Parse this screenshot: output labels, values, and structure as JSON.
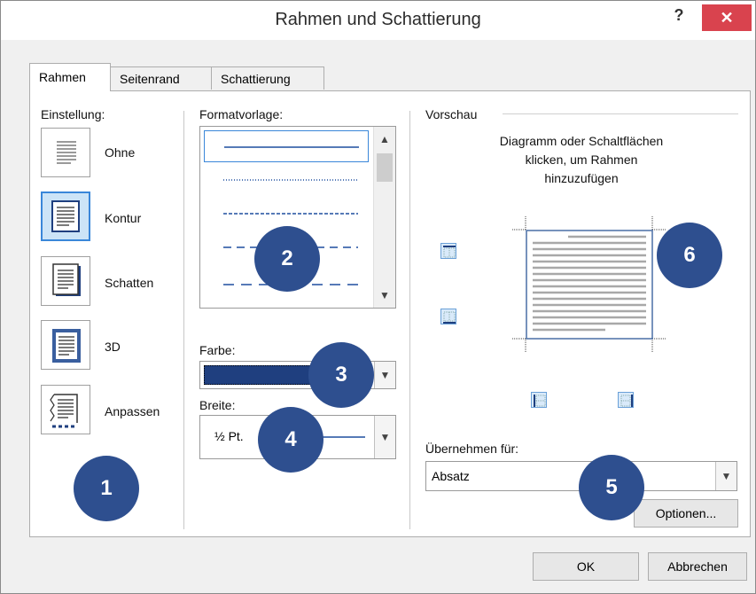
{
  "dialog": {
    "title": "Rahmen und Schattierung",
    "help_label": "?",
    "close_label": "✕"
  },
  "tabs": [
    {
      "label": "Rahmen",
      "active": true
    },
    {
      "label": "Seitenrand",
      "active": false
    },
    {
      "label": "Schattierung",
      "active": false
    }
  ],
  "settings": {
    "header": "Einstellung:",
    "items": [
      {
        "label": "Ohne",
        "icon": "no-border-icon",
        "selected": false
      },
      {
        "label": "Kontur",
        "icon": "box-border-icon",
        "selected": true
      },
      {
        "label": "Schatten",
        "icon": "shadow-border-icon",
        "selected": false
      },
      {
        "label": "3D",
        "icon": "3d-border-icon",
        "selected": false
      },
      {
        "label": "Anpassen",
        "icon": "custom-border-icon",
        "selected": false
      }
    ]
  },
  "style": {
    "header": "Formatvorlage:",
    "items": [
      "solid",
      "dotted",
      "dashed-small",
      "dashed-large",
      "dash-long"
    ]
  },
  "color": {
    "header": "Farbe:",
    "value": "#1f3f7f"
  },
  "width": {
    "header": "Breite:",
    "value": "½ Pt."
  },
  "preview": {
    "header": "Vorschau",
    "instructions": [
      "Diagramm oder Schaltflächen",
      "klicken, um Rahmen",
      "hinzuzufügen"
    ]
  },
  "apply": {
    "header": "Übernehmen für:",
    "value": "Absatz"
  },
  "buttons": {
    "options": "Optionen...",
    "ok": "OK",
    "cancel": "Abbrechen"
  },
  "markers": [
    "1",
    "2",
    "3",
    "4",
    "5",
    "6"
  ],
  "colors": {
    "accent": "#3a87d9",
    "marker": "#2e4f8f",
    "close": "#d9434e"
  }
}
